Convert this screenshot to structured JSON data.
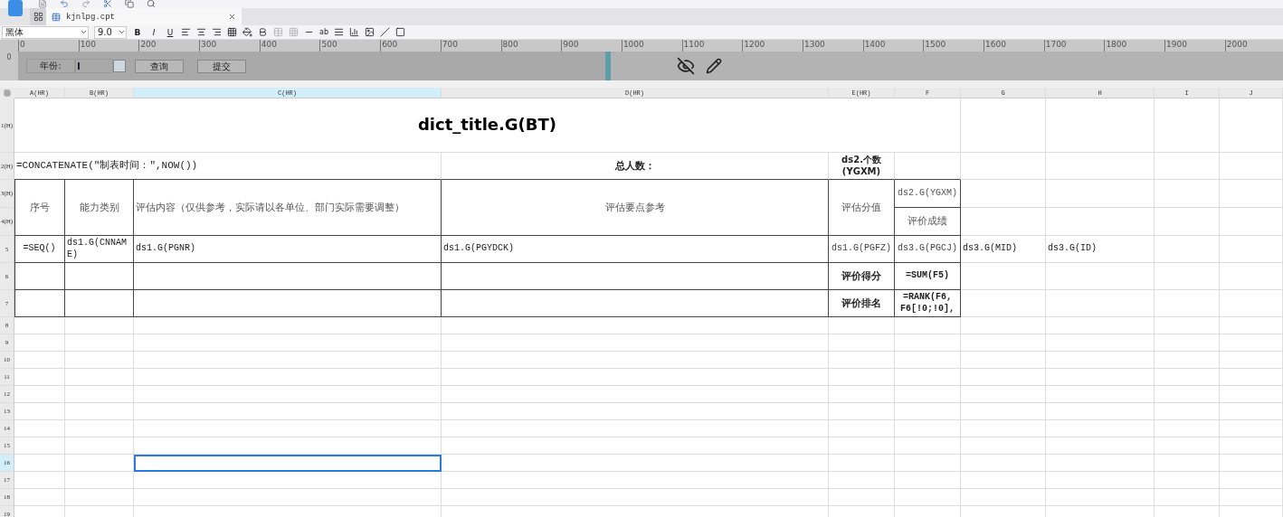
{
  "tab": {
    "title": "kjnlpg.cpt"
  },
  "format_toolbar": {
    "font": "黑体",
    "size": "9.0",
    "styles": [
      "B",
      "I",
      "U"
    ],
    "small_text": "ab"
  },
  "ruler": {
    "vertical": "0",
    "labels": [
      "0",
      "100",
      "200",
      "300",
      "400",
      "500",
      "600",
      "700",
      "800",
      "900",
      "1000",
      "1100",
      "1200",
      "1300",
      "1400",
      "1500",
      "1600",
      "1700",
      "1800",
      "1900",
      "2000"
    ]
  },
  "parameters": {
    "label": "年份:",
    "buttons": [
      "查询",
      "提交"
    ]
  },
  "sheet": {
    "columns": [
      {
        "label": "A(HR)",
        "selected": false
      },
      {
        "label": "B(HR)",
        "selected": false
      },
      {
        "label": "C(HR)",
        "selected": true
      },
      {
        "label": "D(HR)",
        "selected": false
      },
      {
        "label": "E(HR)",
        "selected": false
      },
      {
        "label": "F",
        "selected": false
      },
      {
        "label": "G",
        "selected": false
      },
      {
        "label": "H",
        "selected": false
      },
      {
        "label": "I",
        "selected": false
      },
      {
        "label": "J",
        "selected": false
      }
    ],
    "rows": [
      {
        "label": "1(H)",
        "selected": false
      },
      {
        "label": "2(H)",
        "selected": false
      },
      {
        "label": "3(H)",
        "selected": false
      },
      {
        "label": "4(H)",
        "selected": false
      },
      {
        "label": "5",
        "selected": false
      },
      {
        "label": "6",
        "selected": false
      },
      {
        "label": "7",
        "selected": false
      },
      {
        "label": "8",
        "selected": false
      },
      {
        "label": "9",
        "selected": false
      },
      {
        "label": "10",
        "selected": false
      },
      {
        "label": "11",
        "selected": false
      },
      {
        "label": "12",
        "selected": false
      },
      {
        "label": "13",
        "selected": false
      },
      {
        "label": "14",
        "selected": false
      },
      {
        "label": "15",
        "selected": false
      },
      {
        "label": "16",
        "selected": true
      },
      {
        "label": "17",
        "selected": false
      },
      {
        "label": "18",
        "selected": false
      },
      {
        "label": "19",
        "selected": false
      }
    ],
    "cells": [
      {
        "text": "dict_title.G(BT)"
      },
      {
        "text": "=CONCATENATE(\"制表时间：\",NOW())"
      },
      {
        "text": "总人数："
      },
      {
        "text": "ds2.个数(YGXM)"
      },
      {
        "text": "序号"
      },
      {
        "text": "能力类别"
      },
      {
        "text": "评估内容（仅供参考，实际请以各单位、部门实际需要调整）"
      },
      {
        "text": "评估要点参考"
      },
      {
        "text": "评估分值"
      },
      {
        "text": "ds2.G(YGXM)"
      },
      {
        "text": "评价成绩"
      },
      {
        "text": "=SEQ()"
      },
      {
        "text": "ds1.G(CNNAME)"
      },
      {
        "text": "ds1.G(PGNR)"
      },
      {
        "text": "ds1.G(PGYDCK)"
      },
      {
        "text": "ds1.G(PGFZ)"
      },
      {
        "text": "ds3.G(PGCJ)"
      },
      {
        "text": "ds3.G(MID)"
      },
      {
        "text": "ds3.G(ID)"
      },
      {
        "text": "评价得分"
      },
      {
        "text": "=SUM(F5)"
      },
      {
        "text": "评价排名"
      },
      {
        "text": "=RANK(F6, F6[!0;!0],"
      }
    ]
  }
}
